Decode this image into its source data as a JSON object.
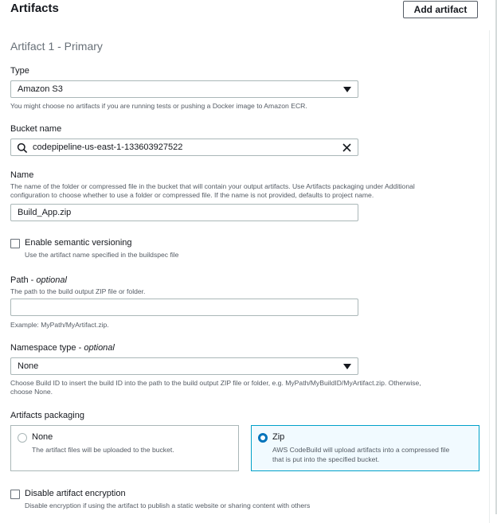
{
  "header": {
    "title": "Artifacts",
    "add_button": "Add artifact"
  },
  "artifact": {
    "section_title": "Artifact 1 - Primary",
    "type": {
      "label": "Type",
      "value": "Amazon S3",
      "help": "You might choose no artifacts if you are running tests or pushing a Docker image to Amazon ECR."
    },
    "bucket": {
      "label": "Bucket name",
      "value": "codepipeline-us-east-1-133603927522"
    },
    "name": {
      "label": "Name",
      "desc_line1": "The name of the folder or compressed file in the bucket that will contain your output artifacts. Use Artifacts packaging under Additional",
      "desc_line2": "configuration to choose whether to use a folder or compressed file. If the name is not provided, defaults to project name.",
      "value": "Build_App.zip"
    },
    "semantic_versioning": {
      "label": "Enable semantic versioning",
      "desc": "Use the artifact name specified in the buildspec file"
    },
    "path": {
      "label": "Path - ",
      "label_optional": "optional",
      "desc": "The path to the build output ZIP file or folder.",
      "value": "",
      "example": "Example: MyPath/MyArtifact.zip."
    },
    "namespace": {
      "label": "Namespace type - ",
      "label_optional": "optional",
      "value": "None",
      "help_line1": "Choose Build ID to insert the build ID into the path to the build output ZIP file or folder, e.g. MyPath/MyBuildID/MyArtifact.zip. Otherwise,",
      "help_line2": "choose None."
    },
    "packaging": {
      "label": "Artifacts packaging",
      "options": [
        {
          "label": "None",
          "desc_line1": "The artifact files will be uploaded to the bucket.",
          "desc_line2": ""
        },
        {
          "label": "Zip",
          "desc_line1": "AWS CodeBuild will upload artifacts into a compressed file",
          "desc_line2": "that is put into the specified bucket."
        }
      ]
    },
    "disable_encryption": {
      "label": "Disable artifact encryption",
      "desc": "Disable encryption if using the artifact to publish a static website or sharing content with others"
    }
  }
}
